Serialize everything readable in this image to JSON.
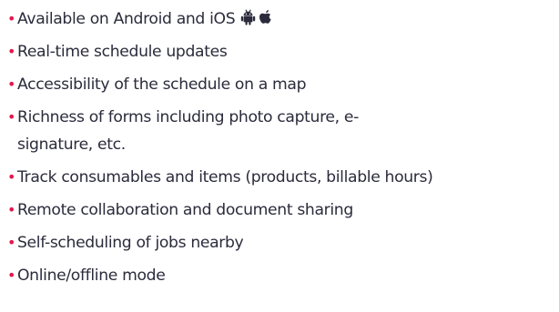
{
  "features": [
    {
      "text": "Available on Android and iOS"
    },
    {
      "text": "Real-time schedule updates"
    },
    {
      "text": "Accessibility of the schedule on a map"
    },
    {
      "text": "Richness of forms including photo capture, e-signature, etc."
    },
    {
      "text": "Track consumables and items (products, billable hours)"
    },
    {
      "text": "Remote collaboration and document sharing"
    },
    {
      "text": "Self-scheduling of jobs nearby"
    },
    {
      "text": "Online/offline mode"
    }
  ],
  "bullet": "•",
  "icons": [
    "android-icon",
    "apple-icon"
  ],
  "colors": {
    "bullet": "#e5174a",
    "text": "#2b2b3c"
  }
}
